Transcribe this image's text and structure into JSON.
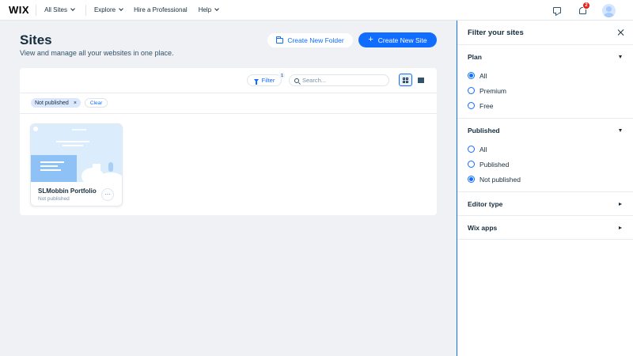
{
  "topbar": {
    "logo": "WIX",
    "nav": [
      {
        "label": "All Sites",
        "has_dropdown": true
      },
      {
        "label": "Explore",
        "has_dropdown": true
      },
      {
        "label": "Hire a Professional",
        "has_dropdown": false
      },
      {
        "label": "Help",
        "has_dropdown": true
      }
    ],
    "notifications_count": "2",
    "icons": [
      "chat-bubble-icon",
      "bell-icon",
      "avatar"
    ]
  },
  "header": {
    "title": "Sites",
    "subtitle": "View and manage all your websites in one place.",
    "create_folder_label": "Create New Folder",
    "create_site_label": "Create New Site"
  },
  "toolbar": {
    "filter_label": "Filter",
    "filter_count": "1",
    "search_placeholder": "Search..."
  },
  "chips": {
    "active_filter": "Not published",
    "remove_glyph": "×",
    "clear_label": "Clear"
  },
  "sites": [
    {
      "name": "SLMobbin Portfolio",
      "status": "Not published",
      "more_glyph": "···"
    }
  ],
  "panel": {
    "title": "Filter your sites",
    "sections": [
      {
        "title": "Plan",
        "expanded": true,
        "options": [
          "All",
          "Premium",
          "Free"
        ],
        "selected": "All"
      },
      {
        "title": "Published",
        "expanded": true,
        "options": [
          "All",
          "Published",
          "Not published"
        ],
        "selected": "Not published"
      },
      {
        "title": "Editor type",
        "expanded": false
      },
      {
        "title": "Wix apps",
        "expanded": false
      }
    ]
  },
  "colors": {
    "accent": "#116dff",
    "background": "#eff1f5",
    "text": "#162d3d",
    "badge": "#e62214"
  }
}
